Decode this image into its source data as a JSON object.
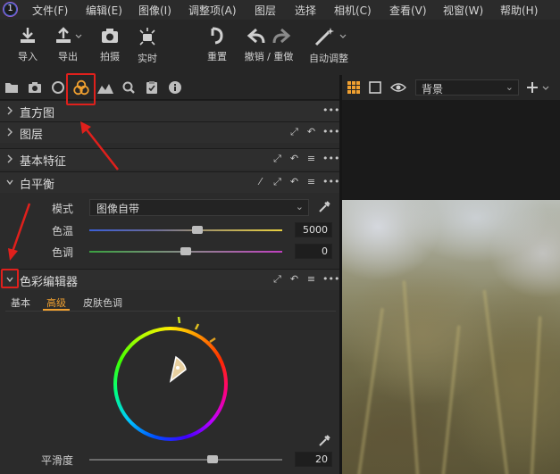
{
  "menu": [
    "文件(F)",
    "编辑(E)",
    "图像(I)",
    "调整项(A)",
    "图层",
    "选择",
    "相机(C)",
    "查看(V)",
    "视窗(W)",
    "帮助(H)"
  ],
  "toolbar": {
    "import": "导入",
    "export": "导出",
    "capture": "拍摄",
    "live": "实时",
    "reset": "重置",
    "undo_redo": "撤销 / 重做",
    "auto_adjust": "自动调整"
  },
  "viewer": {
    "variant_select": "背景"
  },
  "sections": {
    "histogram": "直方图",
    "layers": "图层",
    "basic": "基本特征",
    "white_balance": "白平衡",
    "color_editor": "色彩编辑器"
  },
  "white_balance": {
    "mode_label": "模式",
    "mode_value": "图像自带",
    "kelvin_label": "色温",
    "kelvin_value": "5000",
    "kelvin_level": 0.56,
    "tint_label": "色调",
    "tint_value": "0",
    "tint_level": 0.5
  },
  "color_editor": {
    "tabs": [
      "基本",
      "高级",
      "皮肤色调"
    ],
    "active_tab": "高级",
    "smoothness_label": "平滑度",
    "smoothness_value": "20",
    "smoothness_level": 0.64
  },
  "colors": {
    "accent": "#f0a030",
    "annotation": "#e0201c"
  }
}
